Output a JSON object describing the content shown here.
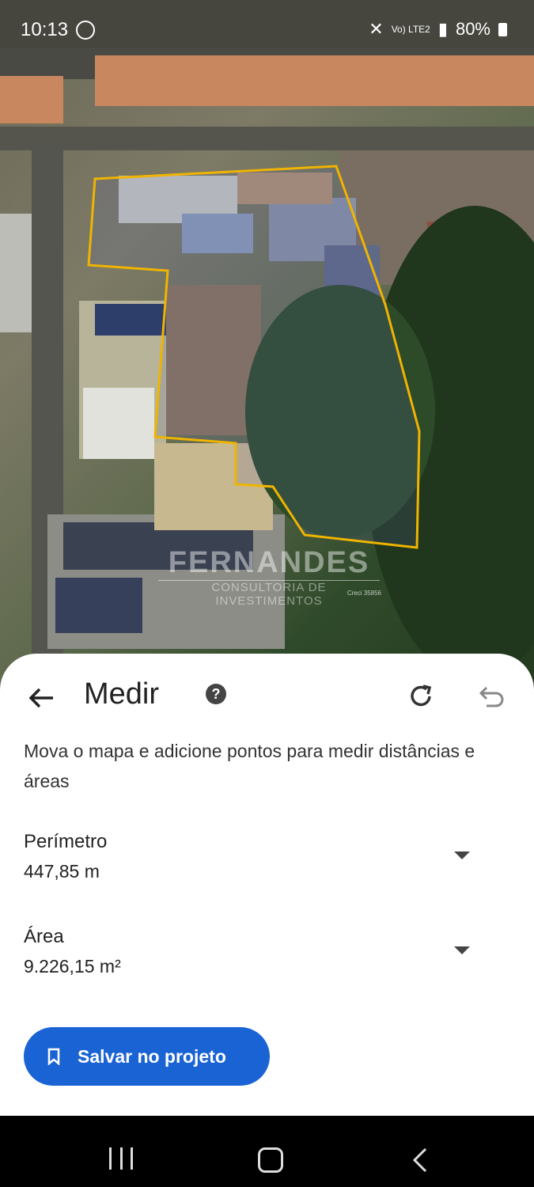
{
  "status": {
    "time": "10:13",
    "battery": "80%",
    "network": "Vo) LTE2"
  },
  "watermark": {
    "brand": "FERNANDES",
    "tagline": "CONSULTORIA DE INVESTIMENTOS",
    "creci": "Creci 35856"
  },
  "panel": {
    "title": "Medir",
    "help_icon": "help-circle-icon",
    "description": "Mova o mapa e adicione pontos para medir distâncias e áreas",
    "perimeter_label": "Perímetro",
    "perimeter_value": "447,85 m",
    "area_label": "Área",
    "area_value": "9.226,15 m²",
    "save_label": "Salvar no projeto",
    "accent": "#1a63d4",
    "outline_color": "#f0b400"
  }
}
